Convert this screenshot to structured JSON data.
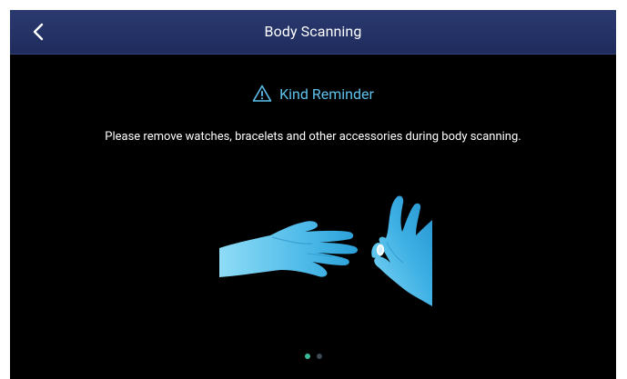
{
  "header": {
    "title": "Body Scanning",
    "back_icon": "chevron-left-icon"
  },
  "reminder": {
    "icon": "warning-triangle-icon",
    "title": "Kind Reminder",
    "color": "#5cc2ec"
  },
  "message": "Please remove watches, bracelets and other accessories during body scanning.",
  "illustration": {
    "icon": "hands-removing-ring-illustration"
  },
  "pagination": {
    "total": 2,
    "active_index": 0,
    "active_color": "#3ab89a",
    "inactive_color": "#3c4a55"
  },
  "colors": {
    "header_bg": "#243266",
    "screen_bg": "#000000",
    "hand_light": "#7fd6f4",
    "hand_dark": "#2aa0d8"
  }
}
